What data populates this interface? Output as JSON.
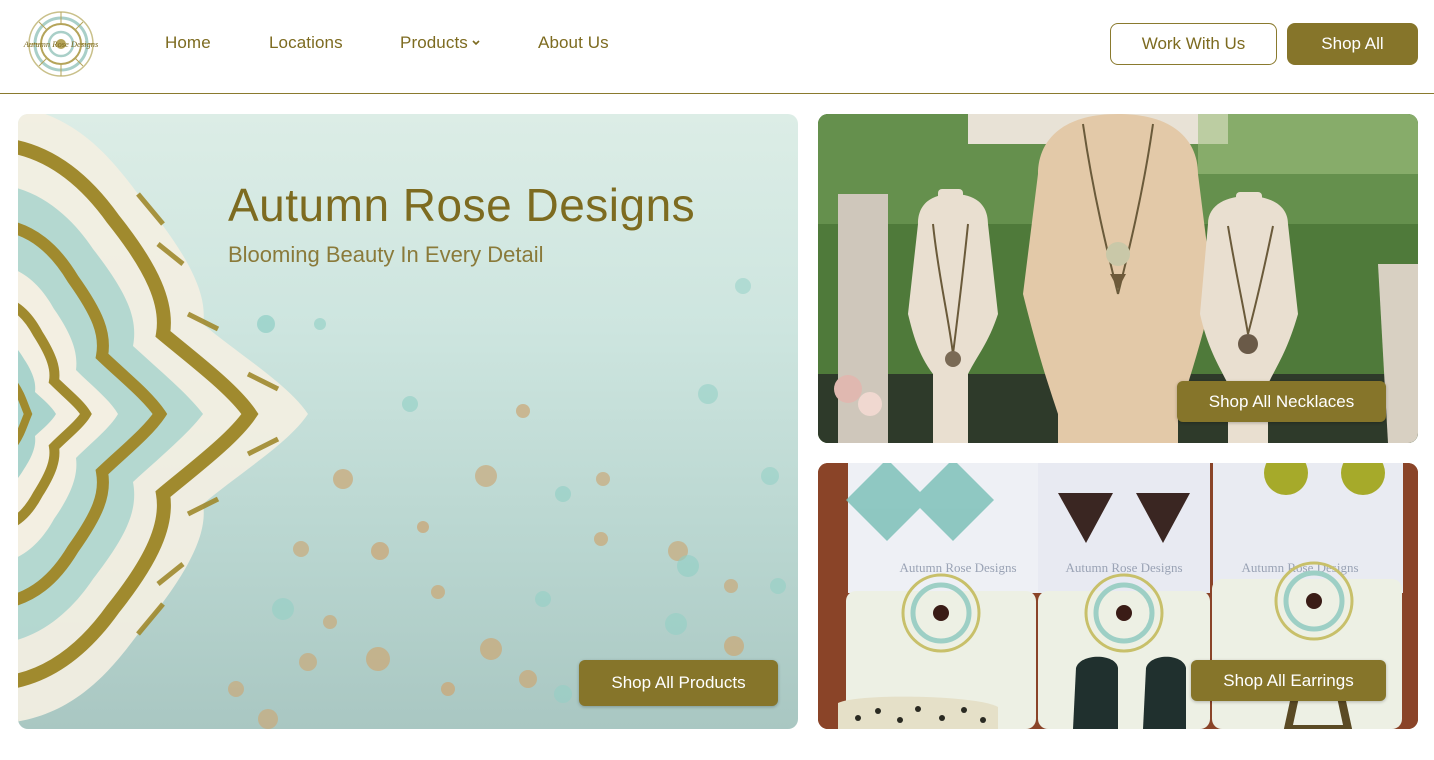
{
  "brand": {
    "logo_text": "Autumn Rose Designs",
    "gold": "#86752a",
    "text_gold": "#7d6b20"
  },
  "nav": {
    "home": "Home",
    "locations": "Locations",
    "products": "Products",
    "about": "About Us"
  },
  "header_actions": {
    "work_with_us": "Work With Us",
    "shop_all": "Shop All"
  },
  "hero": {
    "title": "Autumn Rose Designs",
    "subtitle": "Blooming Beauty In Every Detail",
    "button": "Shop All Products"
  },
  "necklaces": {
    "button": "Shop All Necklaces"
  },
  "earrings": {
    "button": "Shop All Earrings",
    "card_brand_text": "Autumn Rose Designs"
  }
}
